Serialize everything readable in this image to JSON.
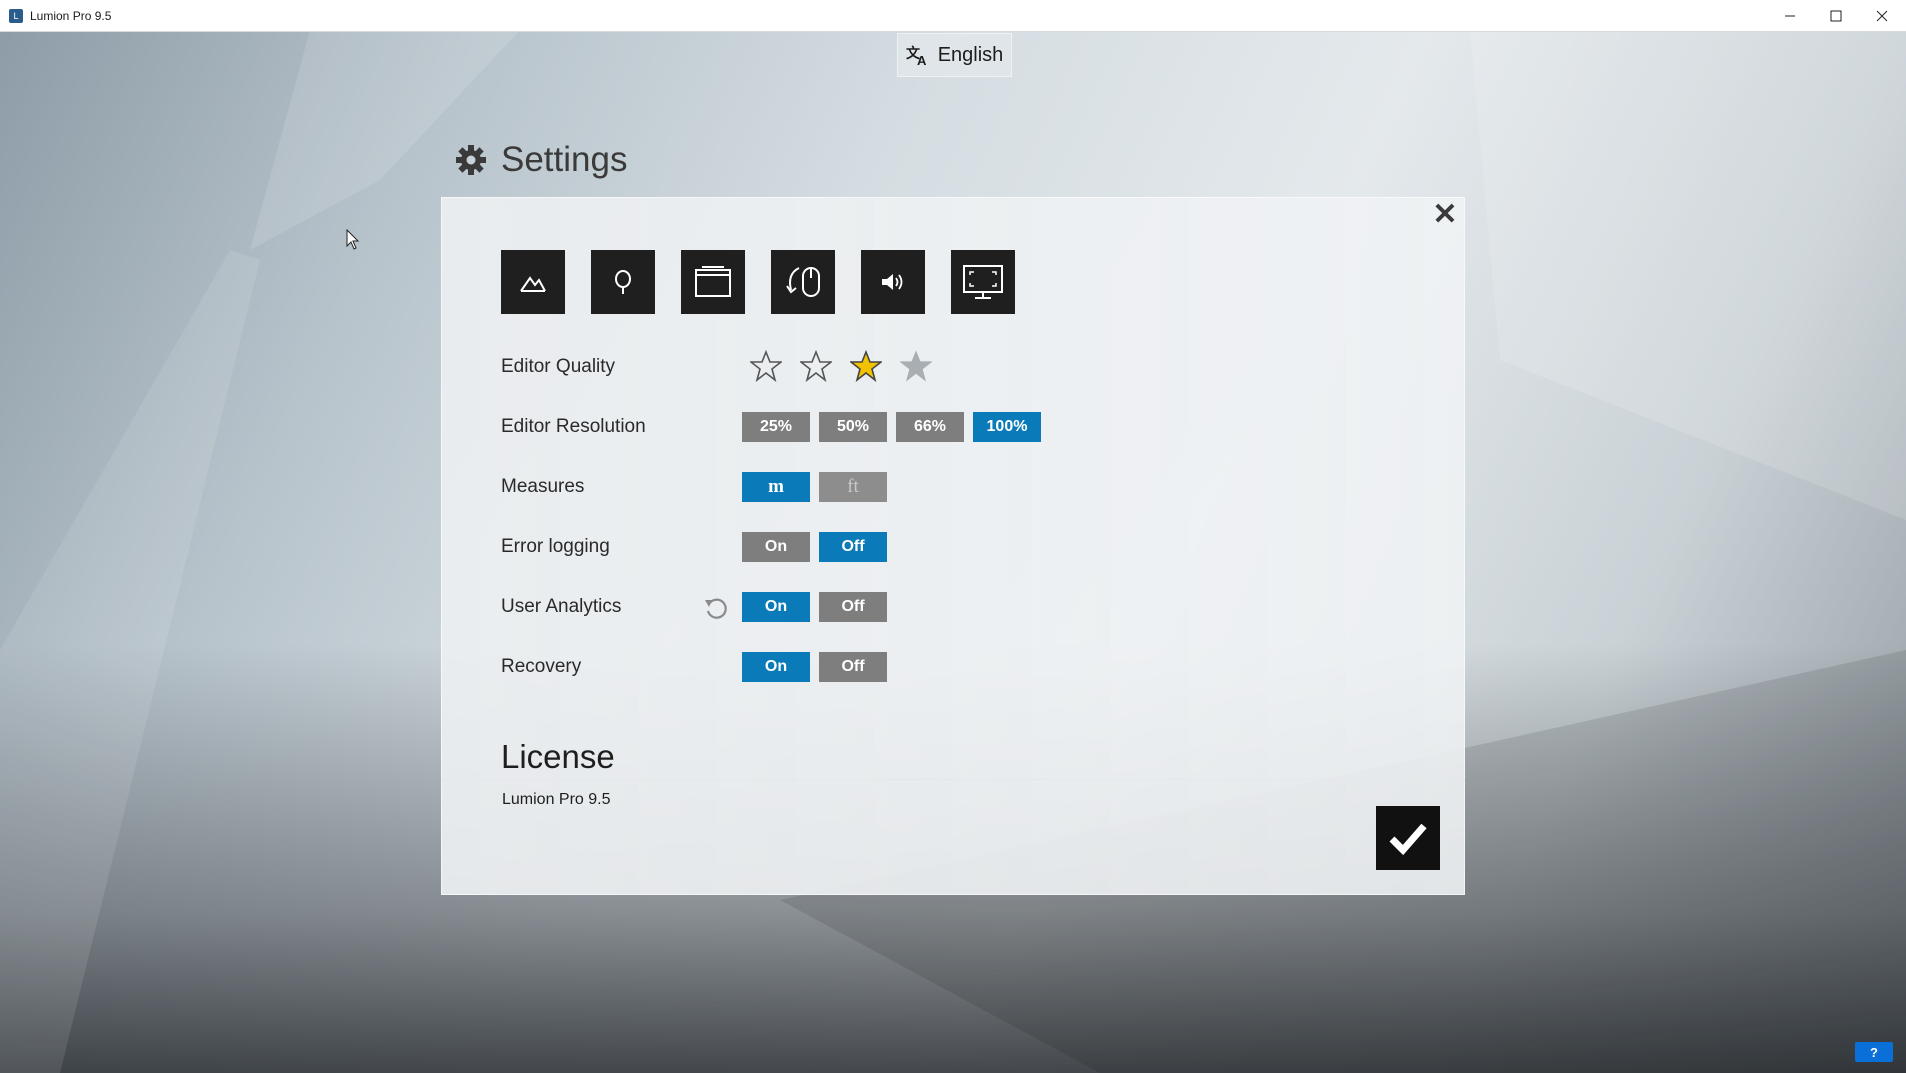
{
  "window": {
    "title": "Lumion Pro 9.5",
    "minimize_icon": "minimize-icon",
    "maximize_icon": "maximize-icon",
    "close_icon": "close-icon"
  },
  "language": {
    "label": "English",
    "icon": "translate-icon"
  },
  "settings": {
    "title": "Settings",
    "title_icon": "gear-icon",
    "tabs": [
      {
        "icon": "landscape-icon"
      },
      {
        "icon": "tree-icon"
      },
      {
        "icon": "window-icon"
      },
      {
        "icon": "mouse-icon"
      },
      {
        "icon": "speaker-icon"
      },
      {
        "icon": "monitor-icon"
      }
    ],
    "rows": {
      "editor_quality": {
        "label": "Editor Quality",
        "selected_stars": 3,
        "max_stars": 4
      },
      "editor_resolution": {
        "label": "Editor Resolution",
        "options": [
          "25%",
          "50%",
          "66%",
          "100%"
        ],
        "selected": "100%"
      },
      "measures": {
        "label": "Measures",
        "options": [
          "m",
          "ft"
        ],
        "selected": "m"
      },
      "error_logging": {
        "label": "Error logging",
        "on": "On",
        "off": "Off",
        "selected": "Off"
      },
      "user_analytics": {
        "label": "User Analytics",
        "on": "On",
        "off": "Off",
        "selected": "On",
        "reset_icon": "reset-icon"
      },
      "recovery": {
        "label": "Recovery",
        "on": "On",
        "off": "Off",
        "selected": "On"
      }
    },
    "license": {
      "title": "License",
      "product": "Lumion Pro 9.5"
    }
  },
  "help": {
    "label": "?"
  },
  "colors": {
    "accent": "#0a7ab8",
    "inactive": "#7e7e7e",
    "star_active": "#f2c200"
  }
}
